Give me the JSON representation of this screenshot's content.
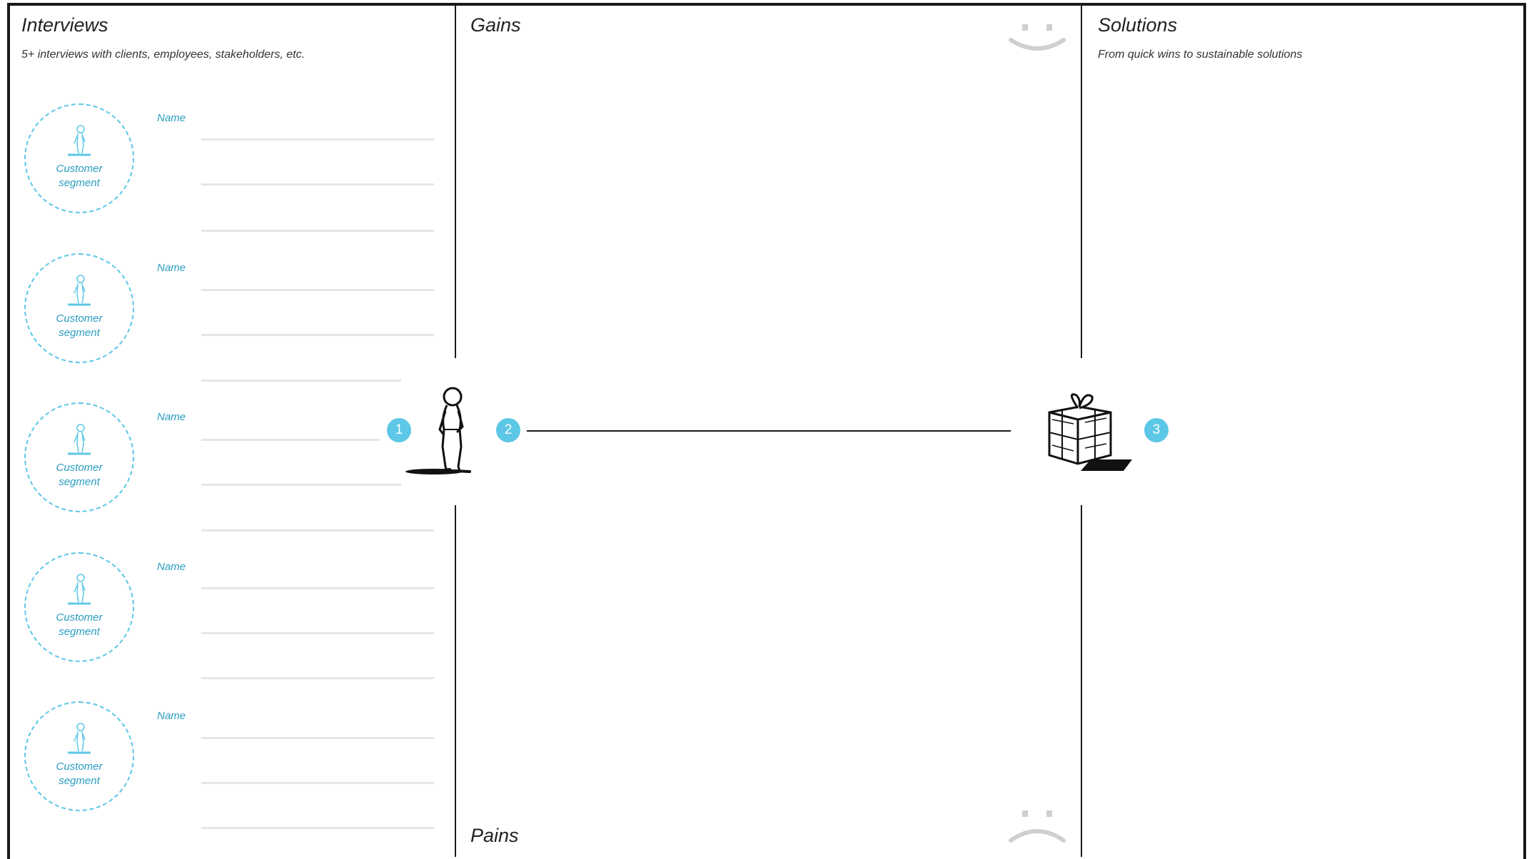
{
  "interviews": {
    "title": "Interviews",
    "subtitle": "5+ interviews with clients, employees, stakeholders, etc.",
    "rows": [
      {
        "segment": "Customer segment",
        "name_label": "Name"
      },
      {
        "segment": "Customer segment",
        "name_label": "Name"
      },
      {
        "segment": "Customer segment",
        "name_label": "Name"
      },
      {
        "segment": "Customer segment",
        "name_label": "Name"
      },
      {
        "segment": "Customer segment",
        "name_label": "Name"
      }
    ]
  },
  "gains": {
    "title": "Gains",
    "icon": "smiley-icon"
  },
  "pains": {
    "title": "Pains",
    "icon": "frown-icon"
  },
  "solutions": {
    "title": "Solutions",
    "subtitle": "From quick wins to sustainable solutions"
  },
  "steps": [
    "1",
    "2",
    "3"
  ],
  "colors": {
    "accent": "#5cc7e6",
    "accent_text": "#2a9dc0",
    "line": "#1a1a1a",
    "field": "#e6e6e6",
    "face": "#cfcfcf"
  }
}
